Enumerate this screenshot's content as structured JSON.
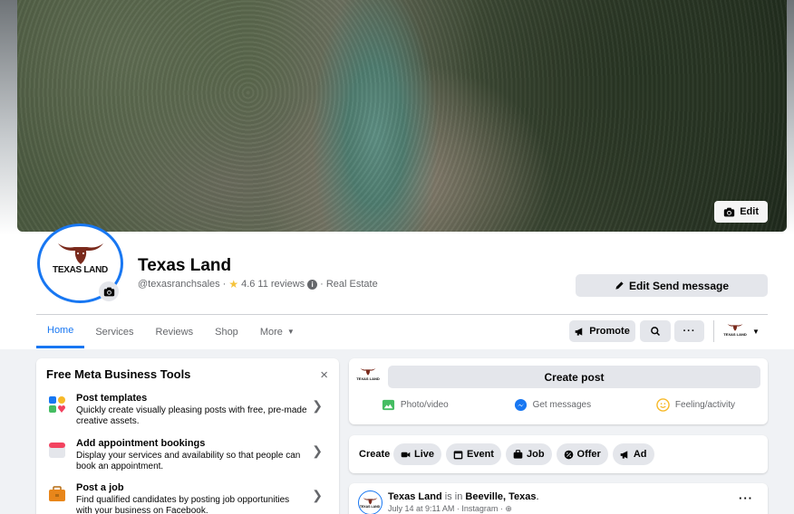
{
  "cover": {
    "edit_label": "Edit"
  },
  "profile": {
    "logo_text": "TEXAS LAND",
    "name": "Texas Land",
    "handle": "@texasranchsales",
    "sep1": "·",
    "star": "★",
    "rating": "4.6",
    "reviews": "11 reviews",
    "info": "i",
    "sep2": "·",
    "category": "Real Estate",
    "edit_send_label": "Edit Send message"
  },
  "tabs": [
    {
      "label": "Home"
    },
    {
      "label": "Services"
    },
    {
      "label": "Reviews"
    },
    {
      "label": "Shop"
    },
    {
      "label": "More"
    }
  ],
  "actions": {
    "promote_label": "Promote",
    "more_dots": "···"
  },
  "tools": {
    "title": "Free Meta Business Tools",
    "close": "×",
    "items": [
      {
        "title": "Post templates",
        "desc": "Quickly create visually pleasing posts with free, pre-made creative assets."
      },
      {
        "title": "Add appointment bookings",
        "desc": "Display your services and availability so that people can book an appointment."
      },
      {
        "title": "Post a job",
        "desc": "Find qualified candidates by posting job opportunities with your business on Facebook."
      }
    ]
  },
  "composer": {
    "create_post_label": "Create post",
    "photo_label": "Photo/video",
    "messages_label": "Get messages",
    "feeling_label": "Feeling/activity"
  },
  "create_bar": {
    "label": "Create",
    "chips": [
      {
        "label": "Live"
      },
      {
        "label": "Event"
      },
      {
        "label": "Job"
      },
      {
        "label": "Offer"
      },
      {
        "label": "Ad"
      }
    ]
  },
  "feed": {
    "author": "Texas Land",
    "is_in": " is in ",
    "location": "Beeville, Texas",
    "period": ".",
    "timestamp": "July 14 at 9:11 AM",
    "dot": " · ",
    "source": "Instagram",
    "dot2": " · ",
    "more_dots": "···"
  },
  "colors": {
    "accent": "#1877f2",
    "button_grey": "#e4e6eb",
    "page_bg": "#f0f2f5"
  }
}
